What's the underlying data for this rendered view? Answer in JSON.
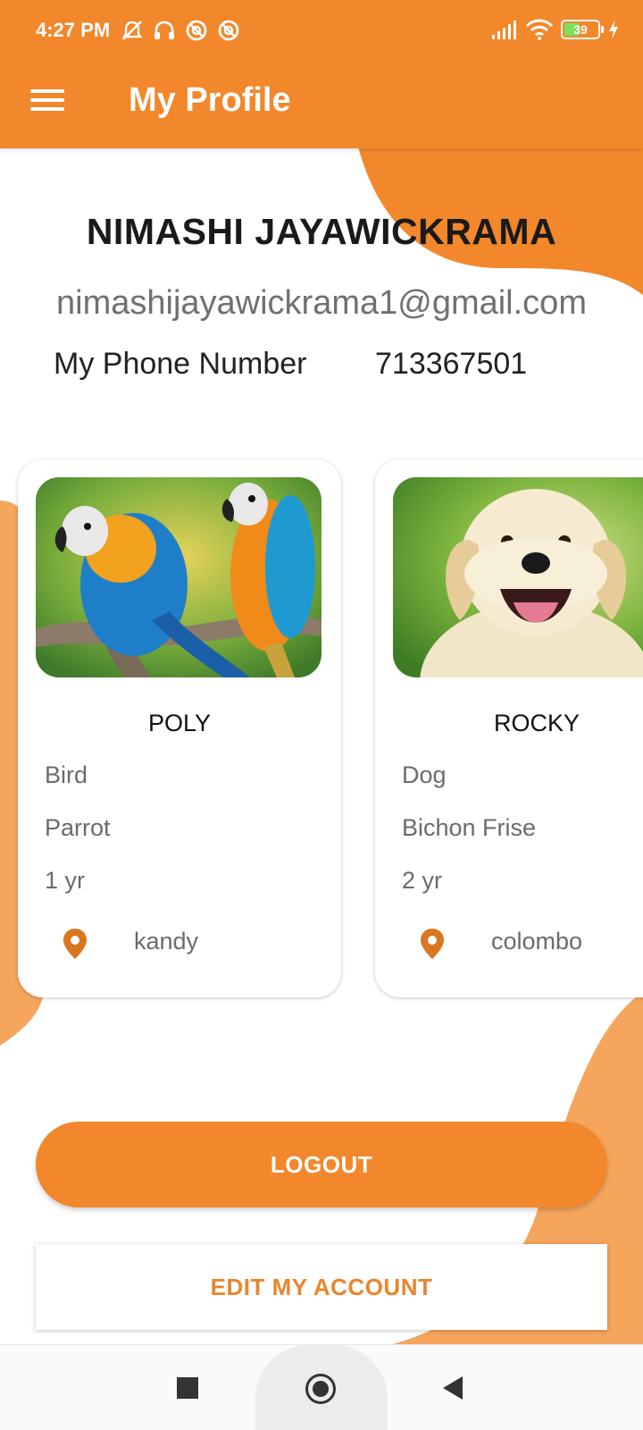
{
  "status_bar": {
    "time": "4:27 PM",
    "battery_level": "39",
    "icons": [
      "alarm-off-icon",
      "headset-icon",
      "app-notification-icon",
      "app-notification-icon",
      "signal-icon",
      "wifi-icon",
      "battery-icon",
      "charging-icon"
    ]
  },
  "app_bar": {
    "title": "My Profile",
    "menu_icon": "hamburger-menu-icon"
  },
  "profile": {
    "name": "NIMASHI JAYAWICKRAMA",
    "email": "nimashijayawickrama1@gmail.com",
    "phone_label": "My Phone Number",
    "phone_value": "713367501"
  },
  "pets": [
    {
      "name": "POLY",
      "type": "Bird",
      "breed": "Parrot",
      "age": "1 yr",
      "location": "kandy",
      "photo": "parrots-photo"
    },
    {
      "name": "ROCKY",
      "type": "Dog",
      "breed": "Bichon Frise",
      "age": "2 yr",
      "location": "colombo",
      "photo": "puppy-photo"
    }
  ],
  "actions": {
    "logout_label": "LOGOUT",
    "edit_label": "EDIT MY ACCOUNT"
  },
  "colors": {
    "accent": "#F2872B",
    "accent_light": "#F6A55C",
    "pin": "#D9761F"
  },
  "nav": {
    "recents_icon": "square-recents-icon",
    "home_icon": "circle-home-icon",
    "back_icon": "triangle-back-icon"
  }
}
